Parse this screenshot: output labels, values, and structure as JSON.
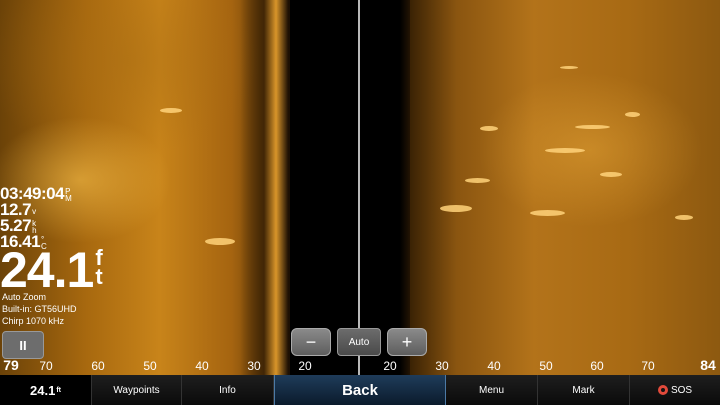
{
  "readouts": {
    "time": "03:49:04",
    "time_unit_top": "P",
    "time_unit_bottom": "M",
    "voltage": "12.7",
    "voltage_unit": "v",
    "speed": "5.27",
    "speed_unit_top": "k",
    "speed_unit_bottom": "h",
    "temperature": "16.41",
    "temperature_unit_top": "°",
    "temperature_unit_bottom": "C",
    "depth": "24.1",
    "depth_unit_top": "f",
    "depth_unit_bottom": "t"
  },
  "info_lines": [
    "Auto Zoom",
    "Built-in: GT56UHD",
    "Chirp 1070 kHz"
  ],
  "pause_label": "II",
  "zoom": {
    "minus": "−",
    "auto": "Auto",
    "plus": "+"
  },
  "range_scale": {
    "left_end": "79",
    "left": [
      "70",
      "60",
      "50",
      "40",
      "30",
      "20"
    ],
    "right": [
      "20",
      "30",
      "40",
      "50",
      "60",
      "70"
    ],
    "right_end": "84"
  },
  "bottom_bar": {
    "depth": "24.1",
    "depth_unit": "ft",
    "waypoints": "Waypoints",
    "info": "Info",
    "back": "Back",
    "menu": "Menu",
    "mark": "Mark",
    "sos": "SOS"
  },
  "colors": {
    "sonar": "#c8841a",
    "back_button": "#1f3c5a",
    "sos_icon": "#e24a3b"
  }
}
